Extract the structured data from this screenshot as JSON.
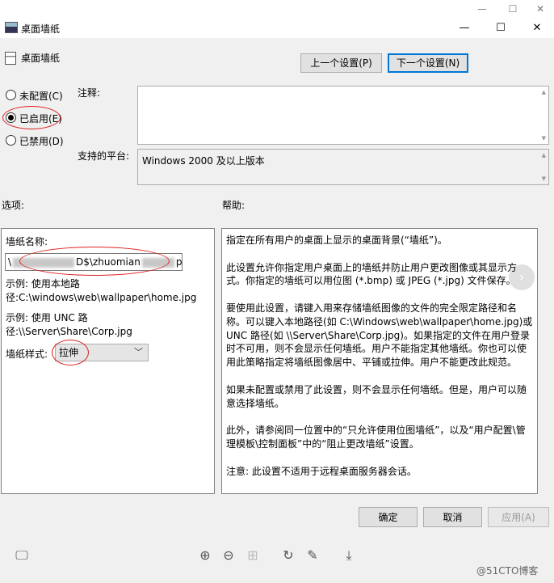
{
  "outer_window": {
    "controls": {
      "minimize": "—",
      "maximize": "☐",
      "close": "✕"
    }
  },
  "dialog": {
    "title": "桌面墙纸",
    "controls": {
      "minimize": "—",
      "maximize": "☐",
      "close": "✕"
    }
  },
  "header": {
    "policy_name": "桌面墙纸",
    "prev_button": "上一个设置(P)",
    "next_button": "下一个设置(N)"
  },
  "state": {
    "not_configured": "未配置(C)",
    "enabled": "已启用(E)",
    "disabled": "已禁用(D)",
    "selected": "enabled"
  },
  "comment": {
    "label": "注释:",
    "value": ""
  },
  "platform": {
    "label": "支持的平台:",
    "value": "Windows 2000 及以上版本"
  },
  "options": {
    "label": "选项:",
    "wallpaper_name_label": "墙纸名称:",
    "wallpaper_name_prefix": "\\",
    "wallpaper_name_visible": "D$\\zhuomian",
    "wallpaper_name_suffix": "p",
    "example_local": "示例: 使用本地路径:C:\\windows\\web\\wallpaper\\home.jpg",
    "example_unc": "示例: 使用 UNC 路径:\\\\Server\\Share\\Corp.jpg",
    "style_label": "墙纸样式:",
    "style_value": "拉伸"
  },
  "help": {
    "label": "帮助:",
    "paragraphs": [
      "指定在所有用户的桌面上显示的桌面背景(“墙纸”)。",
      "此设置允许你指定用户桌面上的墙纸并防止用户更改图像或其显示方式。你指定的墙纸可以用位图 (*.bmp) 或 JPEG (*.jpg) 文件保存。",
      "要使用此设置，请键入用来存储墙纸图像的文件的完全限定路径和名称。可以键入本地路径(如 C:\\Windows\\web\\wallpaper\\home.jpg)或 UNC 路径(如 \\\\Server\\Share\\Corp.jpg)。如果指定的文件在用户登录时不可用，则不会显示任何墙纸。用户不能指定其他墙纸。你也可以使用此策略指定将墙纸图像居中、平铺或拉伸。用户不能更改此规范。",
      "如果未配置或禁用了此设置，则不会显示任何墙纸。但是，用户可以随意选择墙纸。",
      "此外，请参阅同一位置中的“只允许使用位图墙纸”，以及“用户配置\\管理模板\\控制面板”中的“阻止更改墙纸”设置。",
      "注意: 此设置不适用于远程桌面服务器会话。"
    ]
  },
  "footer": {
    "ok": "确定",
    "cancel": "取消",
    "apply": "应用(A)"
  },
  "viewer_toolbar": {
    "icons": [
      "monitor-icon",
      "zoom-in-icon",
      "zoom-out-icon",
      "fit-icon",
      "rotate-icon",
      "edit-icon",
      "download-icon"
    ]
  },
  "watermark": "@51CTO博客",
  "accent_color": "#0078d7",
  "annotation_color": "#e02020"
}
